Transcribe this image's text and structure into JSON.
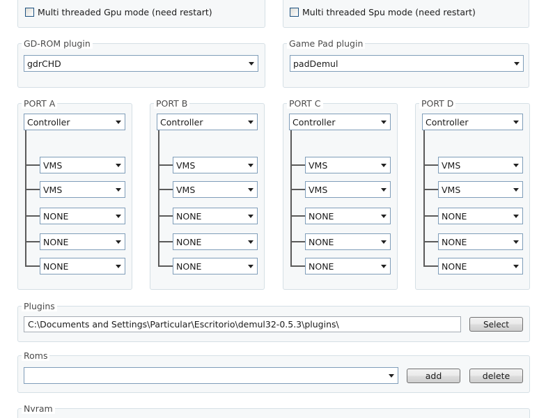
{
  "gpu": {
    "multithread_label": "Multi threaded Gpu mode (need restart)"
  },
  "spu": {
    "multithread_label": "Multi threaded Spu mode (need restart)"
  },
  "gdrom": {
    "label": "GD-ROM plugin",
    "value": "gdrCHD"
  },
  "gamepad": {
    "label": "Game Pad plugin",
    "value": "padDemul"
  },
  "ports": [
    {
      "label": "PORT A",
      "device": "Controller",
      "slots": [
        "VMS",
        "VMS",
        "NONE",
        "NONE",
        "NONE"
      ]
    },
    {
      "label": "PORT B",
      "device": "Controller",
      "slots": [
        "VMS",
        "VMS",
        "NONE",
        "NONE",
        "NONE"
      ]
    },
    {
      "label": "PORT C",
      "device": "Controller",
      "slots": [
        "VMS",
        "VMS",
        "NONE",
        "NONE",
        "NONE"
      ]
    },
    {
      "label": "PORT D",
      "device": "Controller",
      "slots": [
        "VMS",
        "VMS",
        "NONE",
        "NONE",
        "NONE"
      ]
    }
  ],
  "plugins": {
    "label": "Plugins",
    "path": "C:\\Documents and Settings\\Particular\\Escritorio\\demul32-0.5.3\\plugins\\",
    "select_label": "Select"
  },
  "roms": {
    "label": "Roms",
    "value": "",
    "add_label": "add",
    "delete_label": "delete"
  },
  "nvram": {
    "label": "Nvram"
  }
}
